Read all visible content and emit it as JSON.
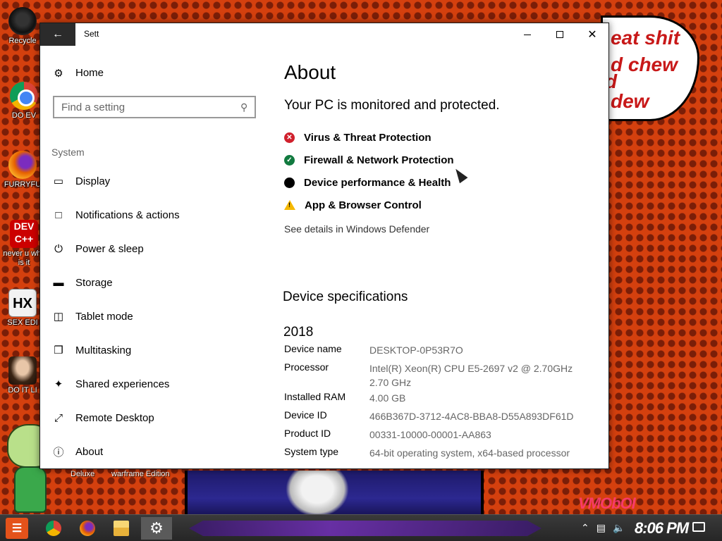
{
  "desktop": {
    "icons": [
      {
        "label": "Recycle"
      },
      {
        "label": "DO EV"
      },
      {
        "label": "FURRYFU"
      },
      {
        "label": "never u why is it",
        "badge": "DEV C++"
      },
      {
        "label": "SEX EDI",
        "badge": "HX"
      },
      {
        "label": "DO IT LI"
      }
    ],
    "bubble_lines": [
      "eat shit",
      "d chew",
      "d",
      "dew"
    ],
    "ad_labels": [
      "Deluxe",
      "warframe Edition"
    ],
    "watermark": "VMObOI"
  },
  "window": {
    "title": "Sett",
    "back_icon": "arrow-left-icon",
    "controls": [
      "minimize",
      "maximize",
      "close"
    ]
  },
  "sidebar": {
    "home_label": "Home",
    "search_placeholder": "Find a setting",
    "section_label": "System",
    "items": [
      {
        "label": "Display",
        "icon": "monitor-icon"
      },
      {
        "label": "Notifications & actions",
        "icon": "notifications-icon"
      },
      {
        "label": "Power & sleep",
        "icon": "power-icon"
      },
      {
        "label": "Storage",
        "icon": "storage-icon"
      },
      {
        "label": "Tablet mode",
        "icon": "tablet-icon"
      },
      {
        "label": "Multitasking",
        "icon": "multitasking-icon"
      },
      {
        "label": "Shared experiences",
        "icon": "shared-icon"
      },
      {
        "label": "Remote Desktop",
        "icon": "remote-icon"
      },
      {
        "label": "About",
        "icon": "info-icon"
      }
    ]
  },
  "main": {
    "title": "About",
    "protection_heading": "Your PC is monitored and protected.",
    "status_items": [
      {
        "label": "Virus & Threat Protection",
        "status": "error",
        "color": "#d0202c"
      },
      {
        "label": "Firewall & Network Protection",
        "status": "ok",
        "color": "#117a3f"
      },
      {
        "label": "Device performance & Health",
        "status": "neutral",
        "color": "#000000"
      },
      {
        "label": "App & Browser Control",
        "status": "warning",
        "color": "#f5b800"
      }
    ],
    "defender_link": "See details in Windows Defender",
    "device_heading": "Device specifications",
    "year": "2018",
    "specs": [
      {
        "key": "Device name",
        "value": "DESKTOP-0P53R7O"
      },
      {
        "key": "Processor",
        "value": "Intel(R) Xeon(R) CPU E5-2697 v2 @ 2.70GHz 2.70 GHz"
      },
      {
        "key": "Installed RAM",
        "value": "4.00 GB"
      },
      {
        "key": "Device ID",
        "value": "466B367D-3712-4AC8-BBA8-D55A893DF61D"
      },
      {
        "key": "Product ID",
        "value": "00331-10000-00001-AA863"
      },
      {
        "key": "System type",
        "value": "64-bit operating system, x64-based processor"
      }
    ]
  },
  "taskbar": {
    "apps": [
      "start",
      "chrome",
      "firefox",
      "file-explorer",
      "settings"
    ],
    "tray_icons": [
      "chevron-up-icon",
      "network-icon",
      "volume-icon"
    ],
    "clock": "8:06 PM"
  },
  "colors": {
    "accent": "#000000",
    "desktop_bg": "#d4400e"
  }
}
